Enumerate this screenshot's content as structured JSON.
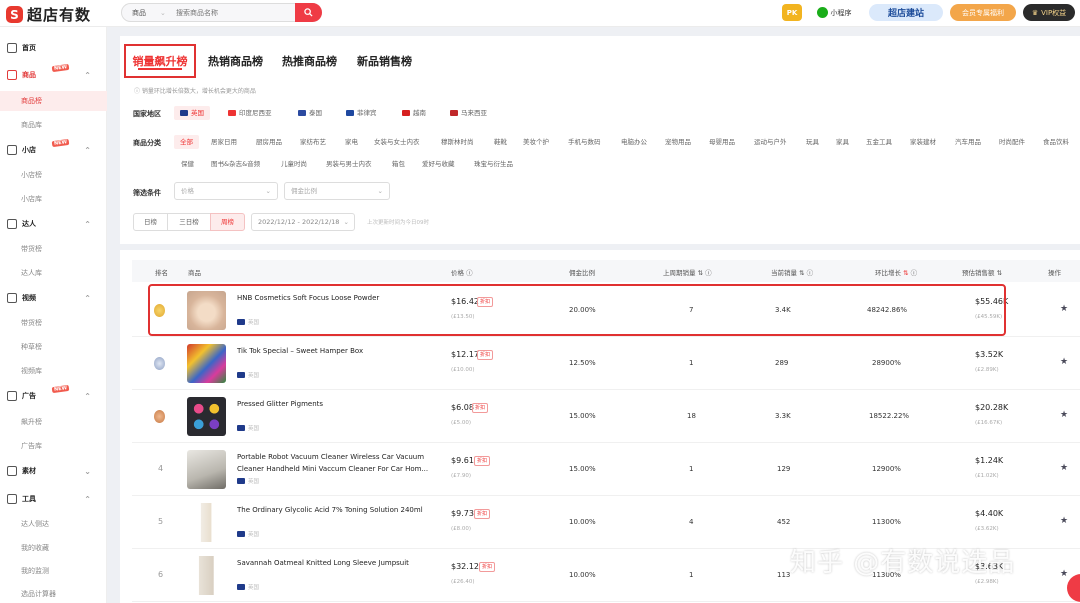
{
  "app": {
    "logo_text": "超店有数"
  },
  "search": {
    "category": "商品",
    "placeholder": "搜索商品名称"
  },
  "top_right": {
    "pk": "PK",
    "mini_program": "小程序",
    "jianzhan": "超店建站",
    "member": "会员专属福利",
    "vip": "VIP权益"
  },
  "sidebar": {
    "home": "首页",
    "goods": "商品",
    "goods_rank": "商品榜",
    "goods_lib": "商品库",
    "shop": "小店",
    "shop_rank": "小店榜",
    "shop_lib": "小店库",
    "talent": "达人",
    "talent_bring": "带货榜",
    "talent_lib": "达人库",
    "video": "视频",
    "video_bring": "带货榜",
    "video_grass": "种草榜",
    "video_lib": "视频库",
    "ads": "广告",
    "ads_rise": "飙升榜",
    "ads_lib": "广告库",
    "material": "素材",
    "tools": "工具",
    "tool_detect": "达人侧达",
    "tool_fav": "我的收藏",
    "tool_monitor": "我的监测",
    "tool_calc": "选品计算器",
    "new_badge": "NEW"
  },
  "tabs": [
    "销量飙升榜",
    "热销商品榜",
    "热推商品榜",
    "新品销售榜"
  ],
  "notice": "销量环比增长倍数大，增长机会更大的商品",
  "filters": {
    "region_label": "国家地区",
    "regions": [
      "英国",
      "印度尼西亚",
      "泰国",
      "菲律宾",
      "越南",
      "马来西亚"
    ],
    "category_label": "商品分类",
    "categories_row1": [
      "全部",
      "居家日用",
      "厨房用品",
      "家纺布艺",
      "家电",
      "女装与女士内衣",
      "穆斯林时尚",
      "鞋靴",
      "美妆个护",
      "手机与数码",
      "电脑办公",
      "宠物用品",
      "母婴用品",
      "运动与户外",
      "玩具",
      "家具",
      "五金工具",
      "家装建材",
      "汽车用品",
      "时尚配件",
      "食品饮料"
    ],
    "categories_row2": [
      "保健",
      "图书&杂志&音频",
      "儿童时尚",
      "男装与男士内衣",
      "箱包",
      "爱好与收藏",
      "珠宝与衍生品"
    ],
    "filter_label": "筛选条件",
    "price_placeholder": "价格",
    "commission_placeholder": "佣金比例",
    "periods": [
      "日榜",
      "三日榜",
      "周榜"
    ],
    "date_range": "2022/12/12 - 2022/12/18",
    "date_hint": "上次更新时间为今日09时"
  },
  "table": {
    "headers": {
      "rank": "排名",
      "product": "商品",
      "price": "价格",
      "commission": "佣金比例",
      "last_week": "上周期销量",
      "current": "当前销量",
      "growth": "环比增长",
      "est_sales": "预估销售额",
      "action": "操作"
    },
    "country": "英国",
    "rows": [
      {
        "rank": "1",
        "name": "HNB Cosmetics Soft Focus Loose Powder",
        "price": "$16.42",
        "orig": "(£13.50)",
        "commission": "20.00%",
        "last": "7",
        "current": "3.4K",
        "growth": "48242.86%",
        "est": "$55.46K",
        "est_orig": "(£45.59K)",
        "discount": "折扣"
      },
      {
        "rank": "2",
        "name": "Tik Tok Special – Sweet Hamper Box",
        "price": "$12.17",
        "orig": "(£10.00)",
        "commission": "12.50%",
        "last": "1",
        "current": "289",
        "growth": "28900%",
        "est": "$3.52K",
        "est_orig": "(£2.89K)",
        "discount": "折扣"
      },
      {
        "rank": "3",
        "name": "Pressed Glitter Pigments",
        "price": "$6.08",
        "orig": "(£5.00)",
        "commission": "15.00%",
        "last": "18",
        "current": "3.3K",
        "growth": "18522.22%",
        "est": "$20.28K",
        "est_orig": "(£16.67K)",
        "discount": "折扣"
      },
      {
        "rank": "4",
        "name": "Portable Robot Vacuum Cleaner Wireless Car Vacuum Cleaner Handheld Mini Vaccum Cleaner For Car Hom...",
        "price": "$9.61",
        "orig": "(£7.90)",
        "commission": "15.00%",
        "last": "1",
        "current": "129",
        "growth": "12900%",
        "est": "$1.24K",
        "est_orig": "(£1.02K)",
        "discount": "折扣"
      },
      {
        "rank": "5",
        "name": "The Ordinary Glycolic Acid 7% Toning Solution 240ml",
        "price": "$9.73",
        "orig": "(£8.00)",
        "commission": "10.00%",
        "last": "4",
        "current": "452",
        "growth": "11300%",
        "est": "$4.40K",
        "est_orig": "(£3.62K)",
        "discount": "折扣"
      },
      {
        "rank": "6",
        "name": "Savannah Oatmeal Knitted Long Sleeve Jumpsuit",
        "price": "$32.12",
        "orig": "(£26.40)",
        "commission": "10.00%",
        "last": "1",
        "current": "113",
        "growth": "11300%",
        "est": "$3.63K",
        "est_orig": "(£2.98K)",
        "discount": "折扣"
      }
    ]
  },
  "watermark": "知乎 @有数说选品",
  "colors": {
    "accent": "#e03131",
    "brand": "#e8392f"
  }
}
